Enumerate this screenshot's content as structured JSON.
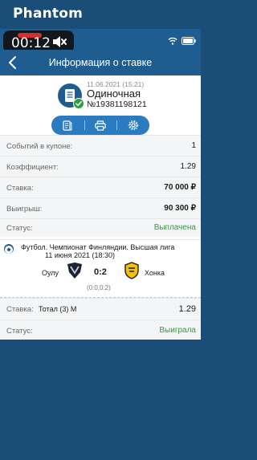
{
  "app": {
    "brand": "Phantom"
  },
  "statusbar": {
    "time": "00:12"
  },
  "header": {
    "title": "Информация о ставке"
  },
  "bet": {
    "date": "11.06.2021 (15:21)",
    "type": "Одиночная",
    "number": "№19381198121"
  },
  "info": {
    "events_label": "Событий в купоне:",
    "events_value": "1",
    "coef_label": "Коэффициент:",
    "coef_value": "1.29",
    "stake_label": "Ставка:",
    "stake_value": "70 000 ₽",
    "win_label": "Выигрыш:",
    "win_value": "90 300 ₽",
    "status_label": "Статус:",
    "status_value": "Выплачена"
  },
  "event": {
    "league": "Футбол. Чемпионат Финляндии. Высшая лига",
    "date": "11 июня 2021 (18:30)",
    "team1": "Оулу",
    "score": "0:2",
    "team2": "Хонка",
    "half_score": "(0:0,0:2)"
  },
  "bet_line": {
    "label": "Ставка:",
    "market": "Тотал (3) М",
    "coef": "1.29"
  },
  "result": {
    "label": "Статус:",
    "value": "Выиграла"
  },
  "colors": {
    "background": "#1a4e78",
    "header": "#1f5d91",
    "accent": "#2b7bc0",
    "success": "#2e9c3f"
  }
}
